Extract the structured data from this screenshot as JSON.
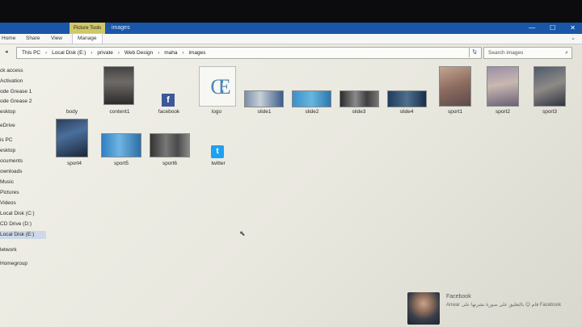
{
  "window": {
    "context_tab": "Picture Tools",
    "title": "images",
    "controls": [
      "—",
      "☐",
      "✕"
    ]
  },
  "ribbon": {
    "tabs": [
      "Home",
      "Share",
      "View",
      "Manage"
    ],
    "expand_caret": "⌄"
  },
  "address": {
    "back_arrow": "◂",
    "crumbs": [
      "This PC",
      "Local Disk (E:)",
      "private",
      "Web Design",
      "maha",
      "images"
    ],
    "separator": "›",
    "dropdown": "⌄",
    "refresh": "↻"
  },
  "search": {
    "placeholder": "Search images",
    "icon": "search-icon"
  },
  "nav": {
    "items": [
      {
        "label": "ck access"
      },
      {
        "label": "Activation"
      },
      {
        "label": "ode Grease 1"
      },
      {
        "label": "ode Grease 2"
      },
      {
        "label": "esktop"
      },
      {
        "label": "eDrive"
      },
      {
        "label": "is PC"
      },
      {
        "label": "esktop"
      },
      {
        "label": "ocuments"
      },
      {
        "label": "ownloads"
      },
      {
        "label": "Music"
      },
      {
        "label": "Pictures"
      },
      {
        "label": "Videos"
      },
      {
        "label": "Local Disk (C:)"
      },
      {
        "label": "CD Drive (D:)"
      },
      {
        "label": "Local Disk (E:)",
        "selected": true
      },
      {
        "label": "letwork"
      },
      {
        "label": "Homegroup"
      }
    ]
  },
  "files": [
    {
      "name": "body",
      "kind": "blank"
    },
    {
      "name": "content1",
      "kind": "photo"
    },
    {
      "name": "facebook",
      "kind": "facebook",
      "glyph": "f"
    },
    {
      "name": "logo",
      "kind": "logo",
      "glyph": "CE"
    },
    {
      "name": "slide1",
      "kind": "photo"
    },
    {
      "name": "slide2",
      "kind": "photo"
    },
    {
      "name": "slide3",
      "kind": "photo"
    },
    {
      "name": "slide4",
      "kind": "photo"
    },
    {
      "name": "sport1",
      "kind": "photo"
    },
    {
      "name": "sport2",
      "kind": "photo"
    },
    {
      "name": "sport3",
      "kind": "photo"
    },
    {
      "name": "sport4",
      "kind": "photo"
    },
    {
      "name": "sport5",
      "kind": "photo"
    },
    {
      "name": "sport6",
      "kind": "photo"
    },
    {
      "name": "twitter",
      "kind": "twitter",
      "glyph": "t"
    }
  ],
  "notification": {
    "title": "Facebook",
    "text": "Anwar قام 😊 بالتعليق على صورة نشرتها على Facebook"
  },
  "colors": {
    "titlebar": "#1a56a8",
    "context_tab": "#cfc86a",
    "facebook": "#3b5998",
    "twitter": "#1da1f2",
    "selection": "#cdd9e8"
  }
}
